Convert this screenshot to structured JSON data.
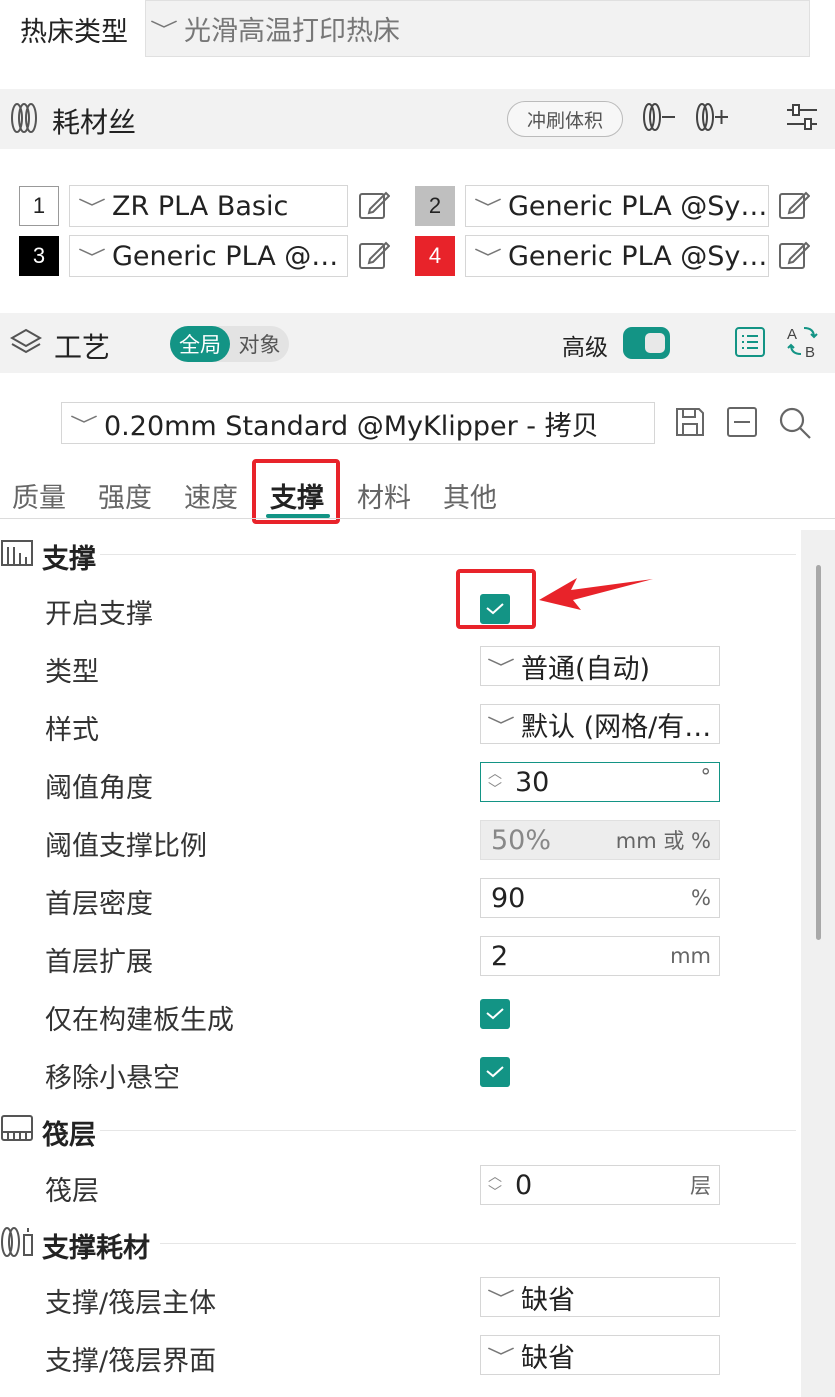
{
  "bed": {
    "label": "热床类型",
    "value": "光滑高温打印热床"
  },
  "filament": {
    "title": "耗材丝",
    "flush_button": "冲刷体积",
    "slots": [
      {
        "index": "1",
        "name": "ZR PLA Basic",
        "color": "#ffffff",
        "text_color": "#222222"
      },
      {
        "index": "2",
        "name": "Generic PLA @System",
        "color": "#bfbfbf",
        "text_color": "#222222"
      },
      {
        "index": "3",
        "name": "Generic PLA @System",
        "color": "#000000",
        "text_color": "#ffffff"
      },
      {
        "index": "4",
        "name": "Generic PLA @System",
        "color": "#e8232a",
        "text_color": "#ffffff"
      }
    ]
  },
  "process": {
    "title": "工艺",
    "toggle_global": "全局",
    "toggle_object": "对象",
    "advanced_label": "高级",
    "preset": "0.20mm Standard @MyKlipper - 拷贝",
    "tabs": [
      "质量",
      "强度",
      "速度",
      "支撑",
      "材料",
      "其他"
    ],
    "active_tab": "支撑"
  },
  "support": {
    "group_title": "支撑",
    "enable_label": "开启支撑",
    "type_label": "类型",
    "type_value": "普通(自动)",
    "style_label": "样式",
    "style_value": "默认 (网格/有机)",
    "threshold_angle_label": "阈值角度",
    "threshold_angle_value": "30",
    "threshold_angle_unit": "°",
    "threshold_ratio_label": "阈值支撑比例",
    "threshold_ratio_value": "50%",
    "threshold_ratio_unit": "mm 或 %",
    "first_layer_density_label": "首层密度",
    "first_layer_density_value": "90",
    "first_layer_density_unit": "%",
    "first_layer_expansion_label": "首层扩展",
    "first_layer_expansion_value": "2",
    "first_layer_expansion_unit": "mm",
    "on_build_plate_label": "仅在构建板生成",
    "remove_small_label": "移除小悬空"
  },
  "raft": {
    "group_title": "筏层",
    "layers_label": "筏层",
    "layers_value": "0",
    "layers_unit": "层"
  },
  "support_filament": {
    "group_title": "支撑耗材",
    "base_label": "支撑/筏层主体",
    "base_value": "缺省",
    "interface_label": "支撑/筏层界面",
    "interface_value": "缺省"
  },
  "colors": {
    "accent": "#139485",
    "highlight": "#e8232a"
  }
}
